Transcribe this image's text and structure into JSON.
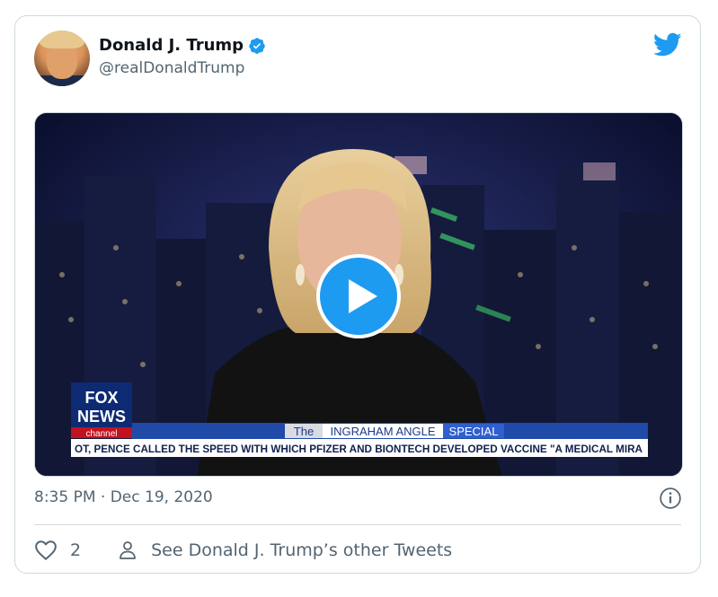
{
  "tweet": {
    "author_name": "Donald J. Trump",
    "handle": "@realDonaldTrump",
    "timestamp": "8:35 PM · Dec 19, 2020",
    "like_count": "2",
    "see_other_tweets": "See Donald J. Trump’s other Tweets"
  },
  "video": {
    "network_logo_top": "FOX",
    "network_logo_middle": "NEWS",
    "network_logo_bottom": "channel",
    "show_title_the": "The",
    "show_title_main": "INGRAHAM ANGLE",
    "show_title_special": "SPECIAL",
    "ticker": "OT, PENCE CALLED THE SPEED WITH WHICH PFIZER AND BIONTECH  DEVELOPED VACCINE \"A MEDICAL MIRA"
  },
  "icons": {
    "verified": "verified-badge-icon",
    "bird": "twitter-bird-icon",
    "play": "play-icon",
    "info": "info-icon",
    "heart": "heart-icon",
    "person": "person-icon"
  },
  "colors": {
    "twitter_blue": "#1d9bf0",
    "text_secondary": "#536471",
    "border": "#cfd9de"
  }
}
